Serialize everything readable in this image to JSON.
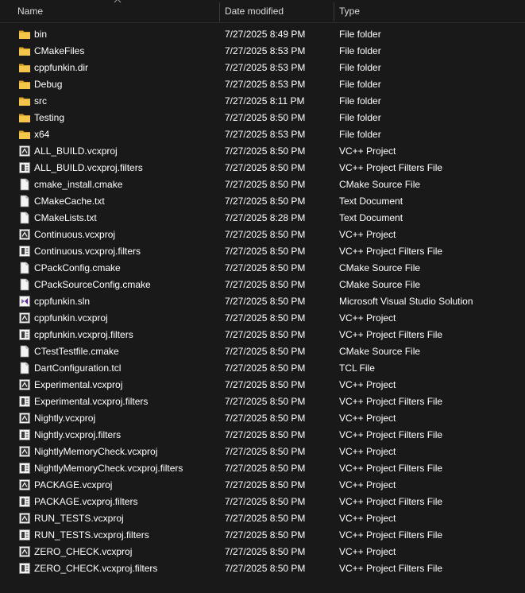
{
  "header": {
    "name": "Name",
    "date_modified": "Date modified",
    "type": "Type"
  },
  "colors": {
    "background": "#191919",
    "text": "#ffffff",
    "folder": "#f3c54b"
  },
  "files": [
    {
      "name": "bin",
      "date": "7/27/2025 8:49 PM",
      "type": "File folder",
      "icon": "folder-icon"
    },
    {
      "name": "CMakeFiles",
      "date": "7/27/2025 8:53 PM",
      "type": "File folder",
      "icon": "folder-icon"
    },
    {
      "name": "cppfunkin.dir",
      "date": "7/27/2025 8:53 PM",
      "type": "File folder",
      "icon": "folder-icon"
    },
    {
      "name": "Debug",
      "date": "7/27/2025 8:53 PM",
      "type": "File folder",
      "icon": "folder-icon"
    },
    {
      "name": "src",
      "date": "7/27/2025 8:11 PM",
      "type": "File folder",
      "icon": "folder-icon"
    },
    {
      "name": "Testing",
      "date": "7/27/2025 8:50 PM",
      "type": "File folder",
      "icon": "folder-icon"
    },
    {
      "name": "x64",
      "date": "7/27/2025 8:53 PM",
      "type": "File folder",
      "icon": "folder-icon"
    },
    {
      "name": "ALL_BUILD.vcxproj",
      "date": "7/27/2025 8:50 PM",
      "type": "VC++ Project",
      "icon": "vcxproj-icon"
    },
    {
      "name": "ALL_BUILD.vcxproj.filters",
      "date": "7/27/2025 8:50 PM",
      "type": "VC++ Project Filters File",
      "icon": "filters-icon"
    },
    {
      "name": "cmake_install.cmake",
      "date": "7/27/2025 8:50 PM",
      "type": "CMake Source File",
      "icon": "document-icon"
    },
    {
      "name": "CMakeCache.txt",
      "date": "7/27/2025 8:50 PM",
      "type": "Text Document",
      "icon": "document-icon"
    },
    {
      "name": "CMakeLists.txt",
      "date": "7/27/2025 8:28 PM",
      "type": "Text Document",
      "icon": "document-icon"
    },
    {
      "name": "Continuous.vcxproj",
      "date": "7/27/2025 8:50 PM",
      "type": "VC++ Project",
      "icon": "vcxproj-icon"
    },
    {
      "name": "Continuous.vcxproj.filters",
      "date": "7/27/2025 8:50 PM",
      "type": "VC++ Project Filters File",
      "icon": "filters-icon"
    },
    {
      "name": "CPackConfig.cmake",
      "date": "7/27/2025 8:50 PM",
      "type": "CMake Source File",
      "icon": "document-icon"
    },
    {
      "name": "CPackSourceConfig.cmake",
      "date": "7/27/2025 8:50 PM",
      "type": "CMake Source File",
      "icon": "document-icon"
    },
    {
      "name": "cppfunkin.sln",
      "date": "7/27/2025 8:50 PM",
      "type": "Microsoft Visual Studio Solution",
      "icon": "sln-icon"
    },
    {
      "name": "cppfunkin.vcxproj",
      "date": "7/27/2025 8:50 PM",
      "type": "VC++ Project",
      "icon": "vcxproj-icon"
    },
    {
      "name": "cppfunkin.vcxproj.filters",
      "date": "7/27/2025 8:50 PM",
      "type": "VC++ Project Filters File",
      "icon": "filters-icon"
    },
    {
      "name": "CTestTestfile.cmake",
      "date": "7/27/2025 8:50 PM",
      "type": "CMake Source File",
      "icon": "document-icon"
    },
    {
      "name": "DartConfiguration.tcl",
      "date": "7/27/2025 8:50 PM",
      "type": "TCL File",
      "icon": "document-icon"
    },
    {
      "name": "Experimental.vcxproj",
      "date": "7/27/2025 8:50 PM",
      "type": "VC++ Project",
      "icon": "vcxproj-icon"
    },
    {
      "name": "Experimental.vcxproj.filters",
      "date": "7/27/2025 8:50 PM",
      "type": "VC++ Project Filters File",
      "icon": "filters-icon"
    },
    {
      "name": "Nightly.vcxproj",
      "date": "7/27/2025 8:50 PM",
      "type": "VC++ Project",
      "icon": "vcxproj-icon"
    },
    {
      "name": "Nightly.vcxproj.filters",
      "date": "7/27/2025 8:50 PM",
      "type": "VC++ Project Filters File",
      "icon": "filters-icon"
    },
    {
      "name": "NightlyMemoryCheck.vcxproj",
      "date": "7/27/2025 8:50 PM",
      "type": "VC++ Project",
      "icon": "vcxproj-icon"
    },
    {
      "name": "NightlyMemoryCheck.vcxproj.filters",
      "date": "7/27/2025 8:50 PM",
      "type": "VC++ Project Filters File",
      "icon": "filters-icon"
    },
    {
      "name": "PACKAGE.vcxproj",
      "date": "7/27/2025 8:50 PM",
      "type": "VC++ Project",
      "icon": "vcxproj-icon"
    },
    {
      "name": "PACKAGE.vcxproj.filters",
      "date": "7/27/2025 8:50 PM",
      "type": "VC++ Project Filters File",
      "icon": "filters-icon"
    },
    {
      "name": "RUN_TESTS.vcxproj",
      "date": "7/27/2025 8:50 PM",
      "type": "VC++ Project",
      "icon": "vcxproj-icon"
    },
    {
      "name": "RUN_TESTS.vcxproj.filters",
      "date": "7/27/2025 8:50 PM",
      "type": "VC++ Project Filters File",
      "icon": "filters-icon"
    },
    {
      "name": "ZERO_CHECK.vcxproj",
      "date": "7/27/2025 8:50 PM",
      "type": "VC++ Project",
      "icon": "vcxproj-icon"
    },
    {
      "name": "ZERO_CHECK.vcxproj.filters",
      "date": "7/27/2025 8:50 PM",
      "type": "VC++ Project Filters File",
      "icon": "filters-icon"
    }
  ]
}
